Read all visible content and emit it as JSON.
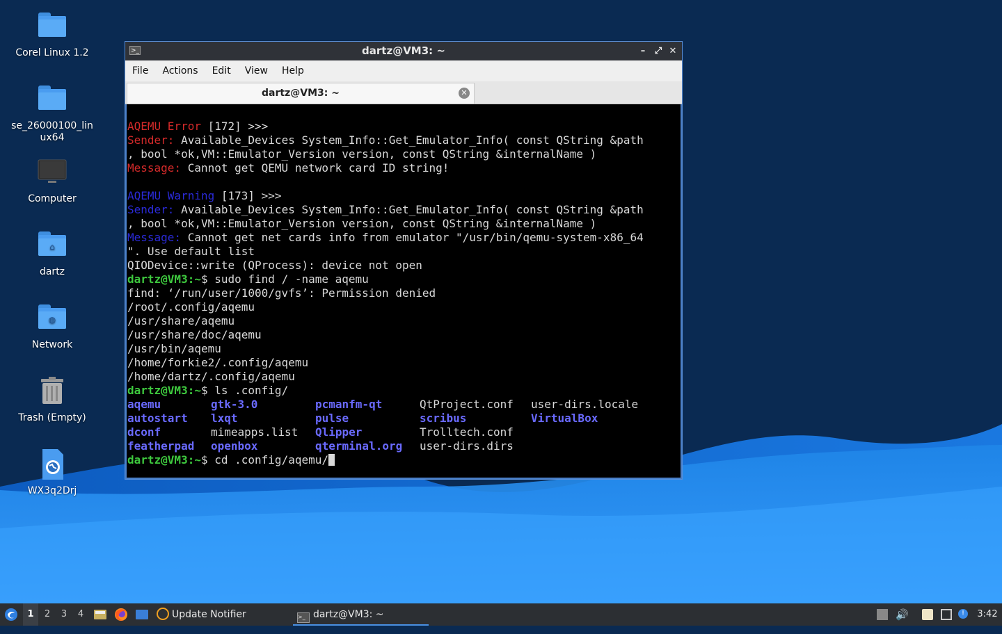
{
  "desktop": {
    "icons": [
      {
        "label": "Corel Linux 1.2",
        "kind": "folder"
      },
      {
        "label": "se_26000100_lin\nux64",
        "kind": "folder"
      },
      {
        "label": "Computer",
        "kind": "computer"
      },
      {
        "label": "dartz",
        "kind": "home-folder"
      },
      {
        "label": "Network",
        "kind": "network-folder"
      },
      {
        "label": "Trash (Empty)",
        "kind": "trash"
      },
      {
        "label": "WX3q2Drj",
        "kind": "web-file"
      }
    ]
  },
  "window": {
    "title": "dartz@VM3: ~",
    "menu": [
      "File",
      "Actions",
      "Edit",
      "View",
      "Help"
    ],
    "tab_label": "dartz@VM3: ~"
  },
  "terminal": {
    "lines": [
      {
        "parts": [
          {
            "t": "AQEMU Error",
            "c": "red"
          },
          {
            "t": " [172] >>>"
          }
        ]
      },
      {
        "parts": [
          {
            "t": "Sender:",
            "c": "red"
          },
          {
            "t": " Available_Devices System_Info::Get_Emulator_Info( const QString &path"
          }
        ]
      },
      {
        "parts": [
          {
            "t": ", bool *ok,VM::Emulator_Version version, const QString &internalName )"
          }
        ]
      },
      {
        "parts": [
          {
            "t": "Message:",
            "c": "red"
          },
          {
            "t": " Cannot get QEMU network card ID string!"
          }
        ]
      },
      {
        "parts": [
          {
            "t": ""
          }
        ]
      },
      {
        "parts": [
          {
            "t": "AQEMU Warning",
            "c": "blu"
          },
          {
            "t": " [173] >>>"
          }
        ]
      },
      {
        "parts": [
          {
            "t": "Sender:",
            "c": "blu"
          },
          {
            "t": " Available_Devices System_Info::Get_Emulator_Info( const QString &path"
          }
        ]
      },
      {
        "parts": [
          {
            "t": ", bool *ok,VM::Emulator_Version version, const QString &internalName )"
          }
        ]
      },
      {
        "parts": [
          {
            "t": "Message:",
            "c": "blu"
          },
          {
            "t": " Cannot get net cards info from emulator \"/usr/bin/qemu-system-x86_64"
          }
        ]
      },
      {
        "parts": [
          {
            "t": "\". Use default list"
          }
        ]
      },
      {
        "parts": [
          {
            "t": "QIODevice::write (QProcess): device not open"
          }
        ]
      },
      {
        "parts": [
          {
            "t": "dartz@VM3",
            "c": "grn"
          },
          {
            "t": ":~",
            "c": "grn"
          },
          {
            "t": "$ sudo find / -name aqemu"
          }
        ]
      },
      {
        "parts": [
          {
            "t": "find: ‘/run/user/1000/gvfs’: Permission denied"
          }
        ]
      },
      {
        "parts": [
          {
            "t": "/root/.config/aqemu"
          }
        ]
      },
      {
        "parts": [
          {
            "t": "/usr/share/aqemu"
          }
        ]
      },
      {
        "parts": [
          {
            "t": "/usr/share/doc/aqemu"
          }
        ]
      },
      {
        "parts": [
          {
            "t": "/usr/bin/aqemu"
          }
        ]
      },
      {
        "parts": [
          {
            "t": "/home/forkie2/.config/aqemu"
          }
        ]
      },
      {
        "parts": [
          {
            "t": "/home/dartz/.config/aqemu"
          }
        ]
      },
      {
        "parts": [
          {
            "t": "dartz@VM3",
            "c": "grn"
          },
          {
            "t": ":~",
            "c": "grn"
          },
          {
            "t": "$ ls .config/"
          }
        ]
      }
    ],
    "ls_rows": [
      [
        {
          "t": "aqemu",
          "c": "dir"
        },
        {
          "t": "gtk-3.0",
          "c": "dir"
        },
        {
          "t": "pcmanfm-qt",
          "c": "dir"
        },
        {
          "t": "QtProject.conf"
        },
        {
          "t": "user-dirs.locale"
        }
      ],
      [
        {
          "t": "autostart",
          "c": "dir"
        },
        {
          "t": "lxqt",
          "c": "dir"
        },
        {
          "t": "pulse",
          "c": "dir"
        },
        {
          "t": "scribus",
          "c": "dir"
        },
        {
          "t": "VirtualBox",
          "c": "dir"
        }
      ],
      [
        {
          "t": "dconf",
          "c": "dir"
        },
        {
          "t": "mimeapps.list"
        },
        {
          "t": "Qlipper",
          "c": "dir"
        },
        {
          "t": "Trolltech.conf"
        },
        {
          "t": ""
        }
      ],
      [
        {
          "t": "featherpad",
          "c": "dir"
        },
        {
          "t": "openbox",
          "c": "dir"
        },
        {
          "t": "qterminal.org",
          "c": "dir"
        },
        {
          "t": "user-dirs.dirs"
        },
        {
          "t": ""
        }
      ]
    ],
    "prompt_user": "dartz@VM3",
    "prompt_path": ":~",
    "current_command": "$ cd .config/aqemu/"
  },
  "taskbar": {
    "workspaces": [
      "1",
      "2",
      "3",
      "4"
    ],
    "active_workspace": "1",
    "tasks": [
      {
        "label": "Update Notifier",
        "icon": "update-notifier-icon"
      },
      {
        "label": "dartz@VM3: ~",
        "icon": "terminal-icon"
      }
    ],
    "clock": "3:42"
  },
  "colors": {
    "terminal_bg": "#000000",
    "error_red": "#d42a2a",
    "warning_blue": "#2a2ad8",
    "prompt_green": "#3ec93e",
    "dir_blue": "#6a6aff",
    "taskbar_bg": "#2c2f33",
    "window_border": "#5a8fd8"
  }
}
